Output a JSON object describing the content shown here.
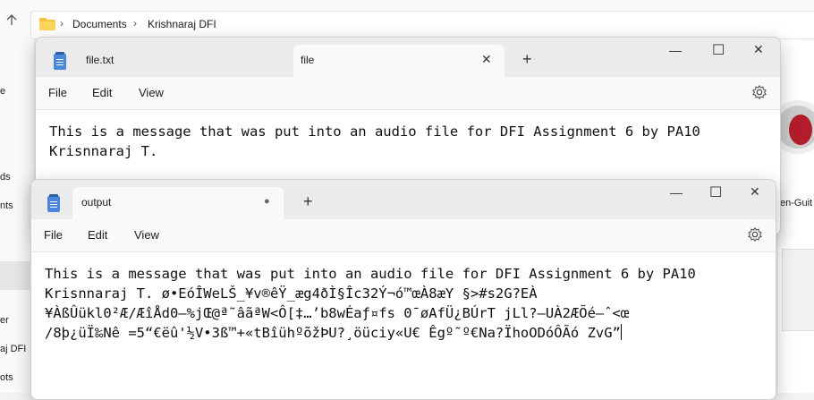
{
  "explorer": {
    "breadcrumb": [
      "Documents",
      "Krishnaraj DFI"
    ],
    "sidebar_labels": [
      "e",
      "ds",
      "nts",
      "er",
      "aj DFI",
      "ots"
    ],
    "thumb_label": "en-Guit"
  },
  "window_back": {
    "tabs": [
      {
        "label": "file.txt",
        "active": false
      },
      {
        "label": "file",
        "active": true
      }
    ],
    "menu": [
      "File",
      "Edit",
      "View"
    ],
    "content": "This is a message that was put into an audio file for DFI Assignment 6 by PA10\nKrisnnaraj T."
  },
  "window_front": {
    "tabs": [
      {
        "label": "output",
        "active": true,
        "unsaved": "●"
      }
    ],
    "menu": [
      "File",
      "Edit",
      "View"
    ],
    "content": "This is a message that was put into an audio file for DFI Assignment 6 by PA10\nKrisnnaraj T. ø•EóÎWeLŠ_¥v®êŸ_æg4ðÌ§Îc32Ý¬ó™œÀ8æY §>#s2G?EÀ\n¥ÀßÛükl0²Æ/ÆîÅd0—%jŒ@ª˜âãªW<Ô[‡…’b8wÉaƒ¤fs 0¯øAfÜ¿BÚrT jLl?—UÀ2ÆÕé—ˆ<œ\n/8þ¿üÏ‰Nê =5“€ëû'½V•3ß™+«tBîühºõžÞU?¸öüciy«U€ Êgº˜º€Na?ÏhoODóÔÃó ZvG”"
  }
}
